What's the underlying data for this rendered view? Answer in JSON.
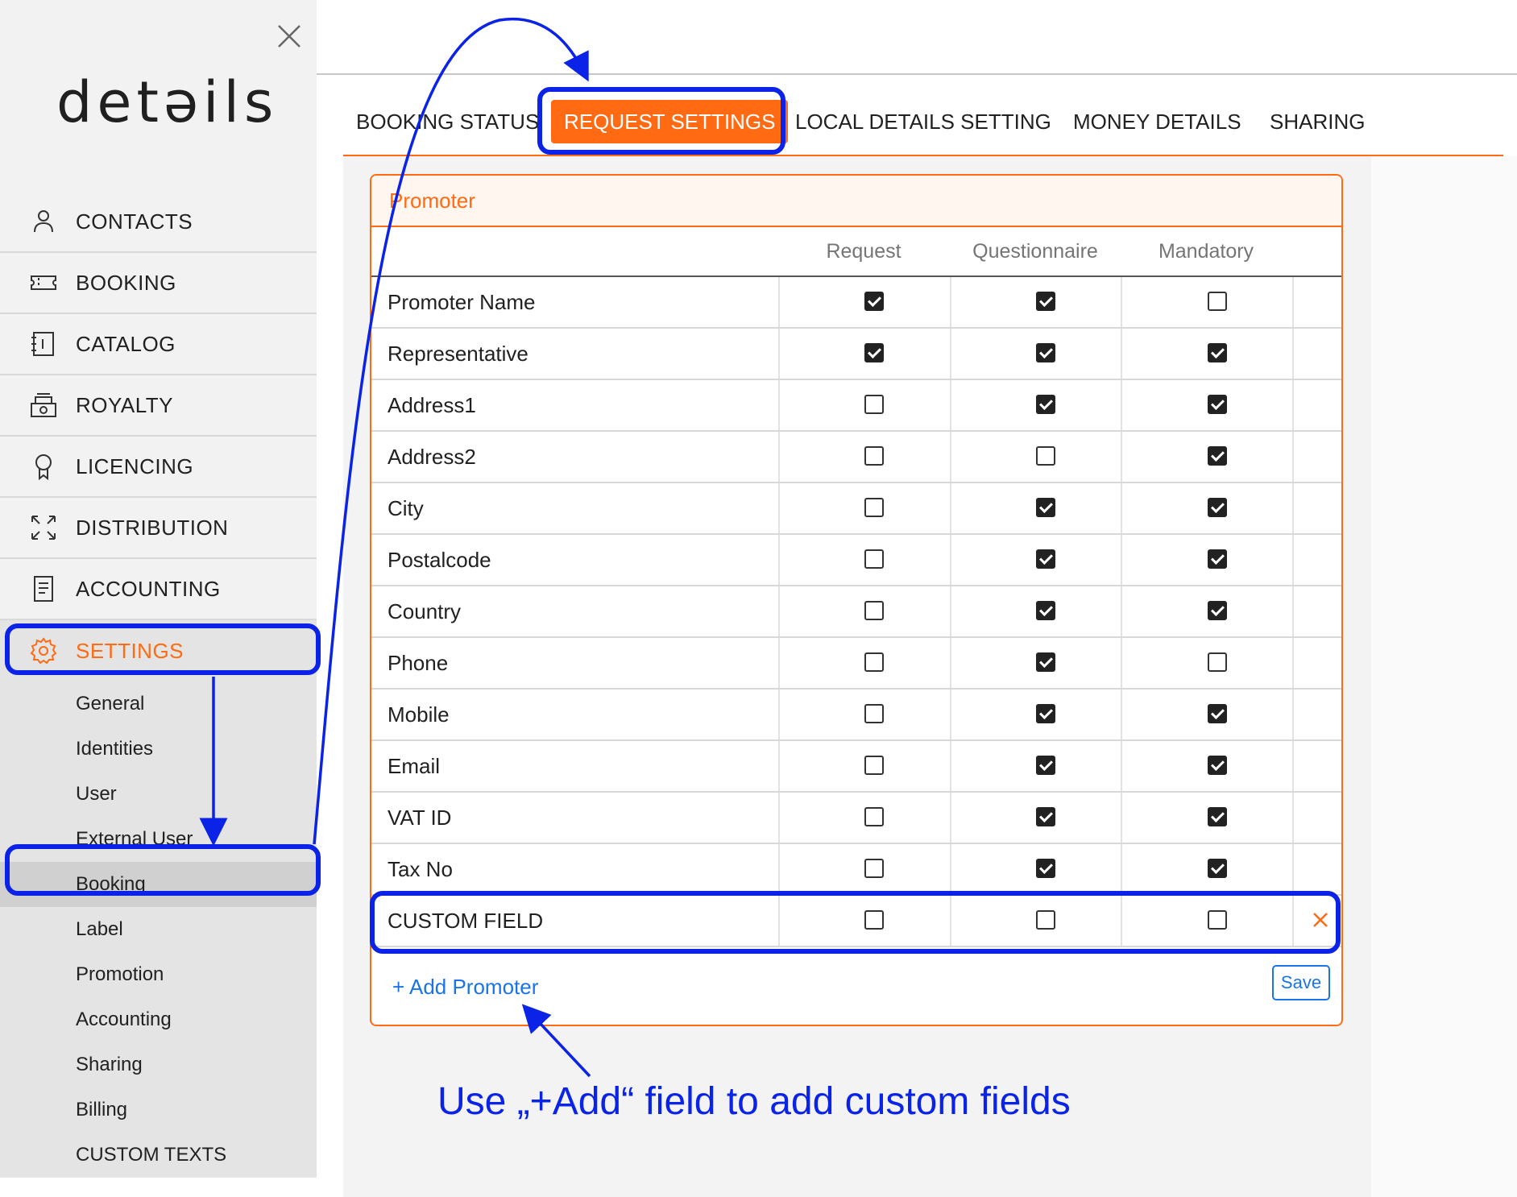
{
  "sidebar": {
    "logo": "detəils",
    "nav": [
      {
        "label": "CONTACTS",
        "icon": "person-icon"
      },
      {
        "label": "BOOKING",
        "icon": "ticket-icon"
      },
      {
        "label": "CATALOG",
        "icon": "catalog-icon"
      },
      {
        "label": "ROYALTY",
        "icon": "cash-register-icon"
      },
      {
        "label": "LICENCING",
        "icon": "award-icon"
      },
      {
        "label": "DISTRIBUTION",
        "icon": "expand-arrows-icon"
      },
      {
        "label": "ACCOUNTING",
        "icon": "document-icon"
      },
      {
        "label": "SETTINGS",
        "icon": "gear-icon"
      }
    ],
    "settings_sub": [
      "General",
      "Identities",
      "User",
      "External User",
      "Booking",
      "Label",
      "Promotion",
      "Accounting",
      "Sharing",
      "Billing",
      "CUSTOM TEXTS"
    ],
    "selected_sub": "Booking"
  },
  "tabs": [
    "BOOKING STATUS",
    "REQUEST SETTINGS",
    "LOCAL DETAILS SETTING",
    "MONEY DETAILS",
    "SHARING"
  ],
  "active_tab": "REQUEST SETTINGS",
  "card": {
    "title": "Promoter",
    "columns": [
      "Request",
      "Questionnaire",
      "Mandatory"
    ],
    "rows": [
      {
        "name": "Promoter Name",
        "request": true,
        "questionnaire": true,
        "mandatory": false
      },
      {
        "name": "Representative",
        "request": true,
        "questionnaire": true,
        "mandatory": true
      },
      {
        "name": "Address1",
        "request": false,
        "questionnaire": true,
        "mandatory": true
      },
      {
        "name": "Address2",
        "request": false,
        "questionnaire": false,
        "mandatory": true
      },
      {
        "name": "City",
        "request": false,
        "questionnaire": true,
        "mandatory": true
      },
      {
        "name": "Postalcode",
        "request": false,
        "questionnaire": true,
        "mandatory": true
      },
      {
        "name": "Country",
        "request": false,
        "questionnaire": true,
        "mandatory": true
      },
      {
        "name": "Phone",
        "request": false,
        "questionnaire": true,
        "mandatory": false
      },
      {
        "name": "Mobile",
        "request": false,
        "questionnaire": true,
        "mandatory": true
      },
      {
        "name": "Email",
        "request": false,
        "questionnaire": true,
        "mandatory": true
      },
      {
        "name": "VAT ID",
        "request": false,
        "questionnaire": true,
        "mandatory": true
      },
      {
        "name": "Tax No",
        "request": false,
        "questionnaire": true,
        "mandatory": true
      },
      {
        "name": "CUSTOM FIELD",
        "request": false,
        "questionnaire": false,
        "mandatory": false,
        "removable": true
      }
    ],
    "add_label": "+ Add Promoter",
    "save_label": "Save"
  },
  "annotation": {
    "text": "Use „+Add“ field to add custom fields"
  },
  "colors": {
    "accent": "#ff6a13",
    "link": "#1a73e8",
    "annotation": "#0a23e6"
  }
}
